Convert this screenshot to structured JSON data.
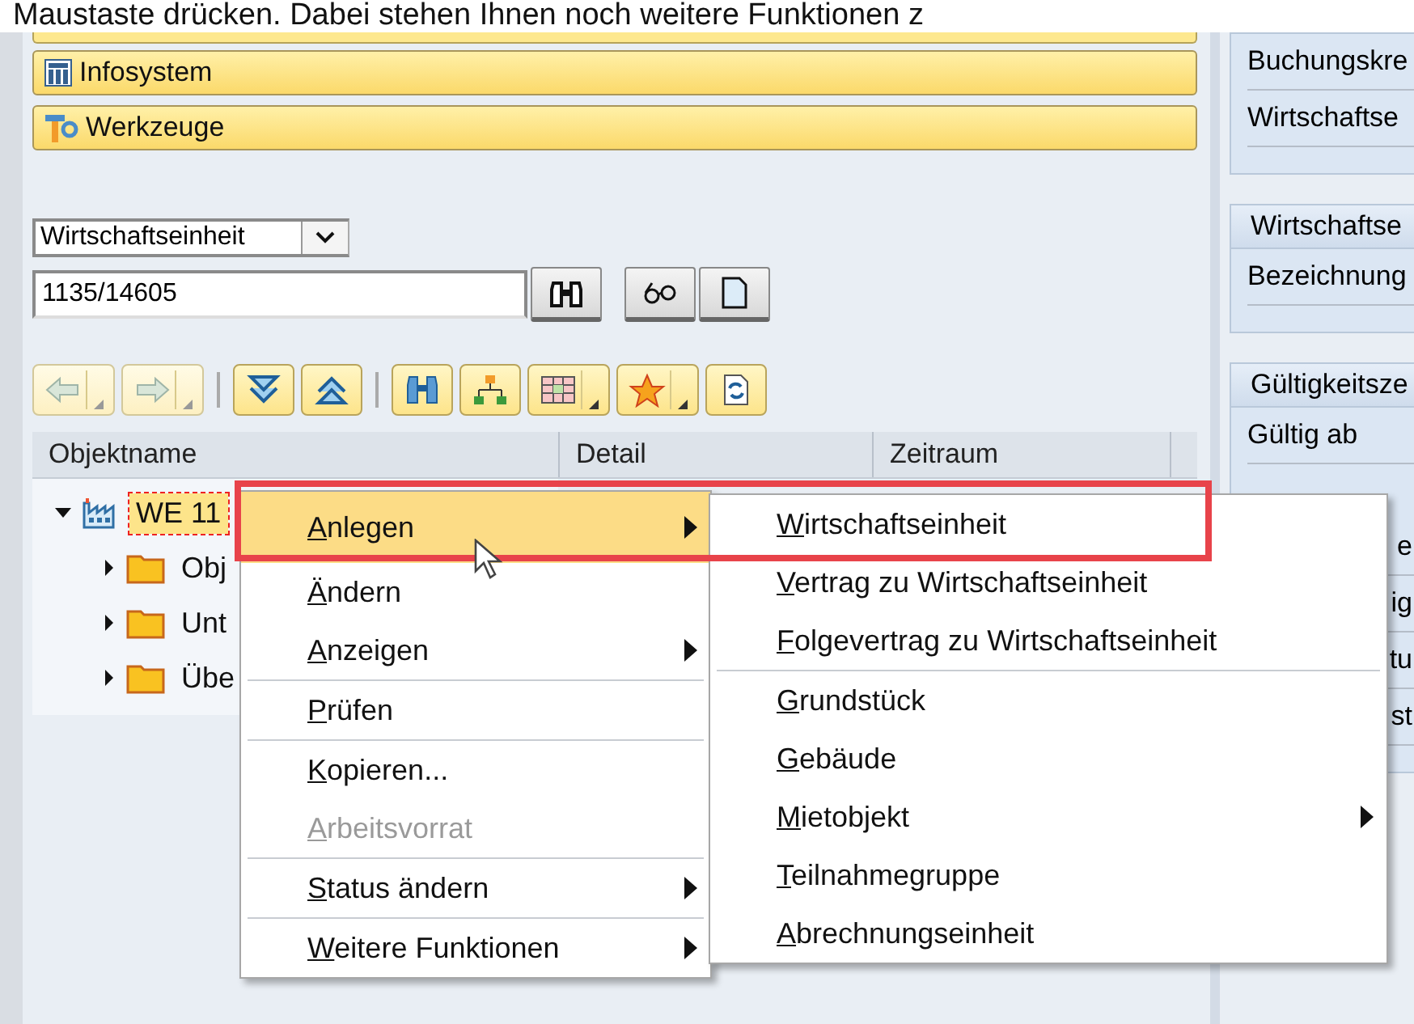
{
  "caption": "Maustaste drücken. Dabei stehen Ihnen noch weitere Funktionen z",
  "nav_buttons": [
    {
      "label": "Infosystem",
      "kind": "info"
    },
    {
      "label": "Werkzeuge",
      "kind": "tools"
    }
  ],
  "object_type": {
    "value": "Wirtschaftseinheit"
  },
  "object_id": {
    "value": "1135/14605"
  },
  "toolbar": [
    [
      {
        "kind": "back",
        "disabled": true,
        "dropdown": true
      },
      {
        "kind": "forward",
        "disabled": true,
        "dropdown": true
      }
    ],
    [
      {
        "kind": "expand",
        "disabled": false,
        "dropdown": false
      },
      {
        "kind": "collapse",
        "disabled": false,
        "dropdown": false
      }
    ],
    [
      {
        "kind": "find",
        "disabled": false,
        "dropdown": false
      },
      {
        "kind": "hierarchy",
        "disabled": false,
        "dropdown": false
      },
      {
        "kind": "layout",
        "disabled": false,
        "dropdown": true
      },
      {
        "kind": "favorites",
        "disabled": false,
        "dropdown": true
      },
      {
        "kind": "refresh",
        "disabled": false,
        "dropdown": false
      }
    ]
  ],
  "tree": {
    "columns": [
      "Objektname",
      "Detail",
      "Zeitraum"
    ],
    "nodes": [
      {
        "label": "WE 11",
        "kind": "unit",
        "expanded": true,
        "selected": true,
        "children": [
          {
            "label": "Obj",
            "kind": "folder",
            "expanded": false,
            "selected": false
          },
          {
            "label": "Unt",
            "kind": "folder",
            "expanded": false,
            "selected": false
          },
          {
            "label": "Übe",
            "kind": "folder",
            "expanded": false,
            "selected": false
          }
        ]
      }
    ]
  },
  "context_menu": {
    "groups": [
      [
        {
          "label": "Anlegen",
          "selected": true,
          "disabled": false,
          "submenu": true
        },
        {
          "label": "Ändern",
          "selected": false,
          "disabled": false,
          "submenu": false
        },
        {
          "label": "Anzeigen",
          "selected": false,
          "disabled": false,
          "submenu": true
        }
      ],
      [
        {
          "label": "Prüfen",
          "selected": false,
          "disabled": false,
          "submenu": false
        }
      ],
      [
        {
          "label": "Kopieren...",
          "selected": false,
          "disabled": false,
          "submenu": false
        },
        {
          "label": "Arbeitsvorrat",
          "selected": false,
          "disabled": true,
          "submenu": false
        }
      ],
      [
        {
          "label": "Status ändern",
          "selected": false,
          "disabled": false,
          "submenu": true
        }
      ],
      [
        {
          "label": "Weitere Funktionen",
          "selected": false,
          "disabled": false,
          "submenu": true
        }
      ]
    ]
  },
  "submenu": {
    "groups": [
      [
        {
          "label": "Wirtschaftseinheit",
          "submenu": false
        },
        {
          "label": "Vertrag zu Wirtschaftseinheit",
          "submenu": false
        },
        {
          "label": "Folgevertrag zu Wirtschaftseinheit",
          "submenu": false
        }
      ],
      [
        {
          "label": "Grundstück",
          "submenu": false
        },
        {
          "label": "Gebäude",
          "submenu": false
        },
        {
          "label": "Mietobjekt",
          "submenu": true
        },
        {
          "label": "Teilnahmegruppe",
          "submenu": false
        },
        {
          "label": "Abrechnungseinheit",
          "submenu": false
        }
      ]
    ]
  },
  "right_panel": {
    "sections": [
      {
        "rows": [
          "Buchungskre",
          "Wirtschaftse"
        ]
      },
      {
        "title": "Wirtschaftse",
        "rows": [
          "Bezeichnung"
        ]
      },
      {
        "title": "Gültigkeitsze",
        "rows": [
          "Gültig ab",
          "e",
          "ig",
          "tu",
          "st"
        ]
      }
    ]
  }
}
